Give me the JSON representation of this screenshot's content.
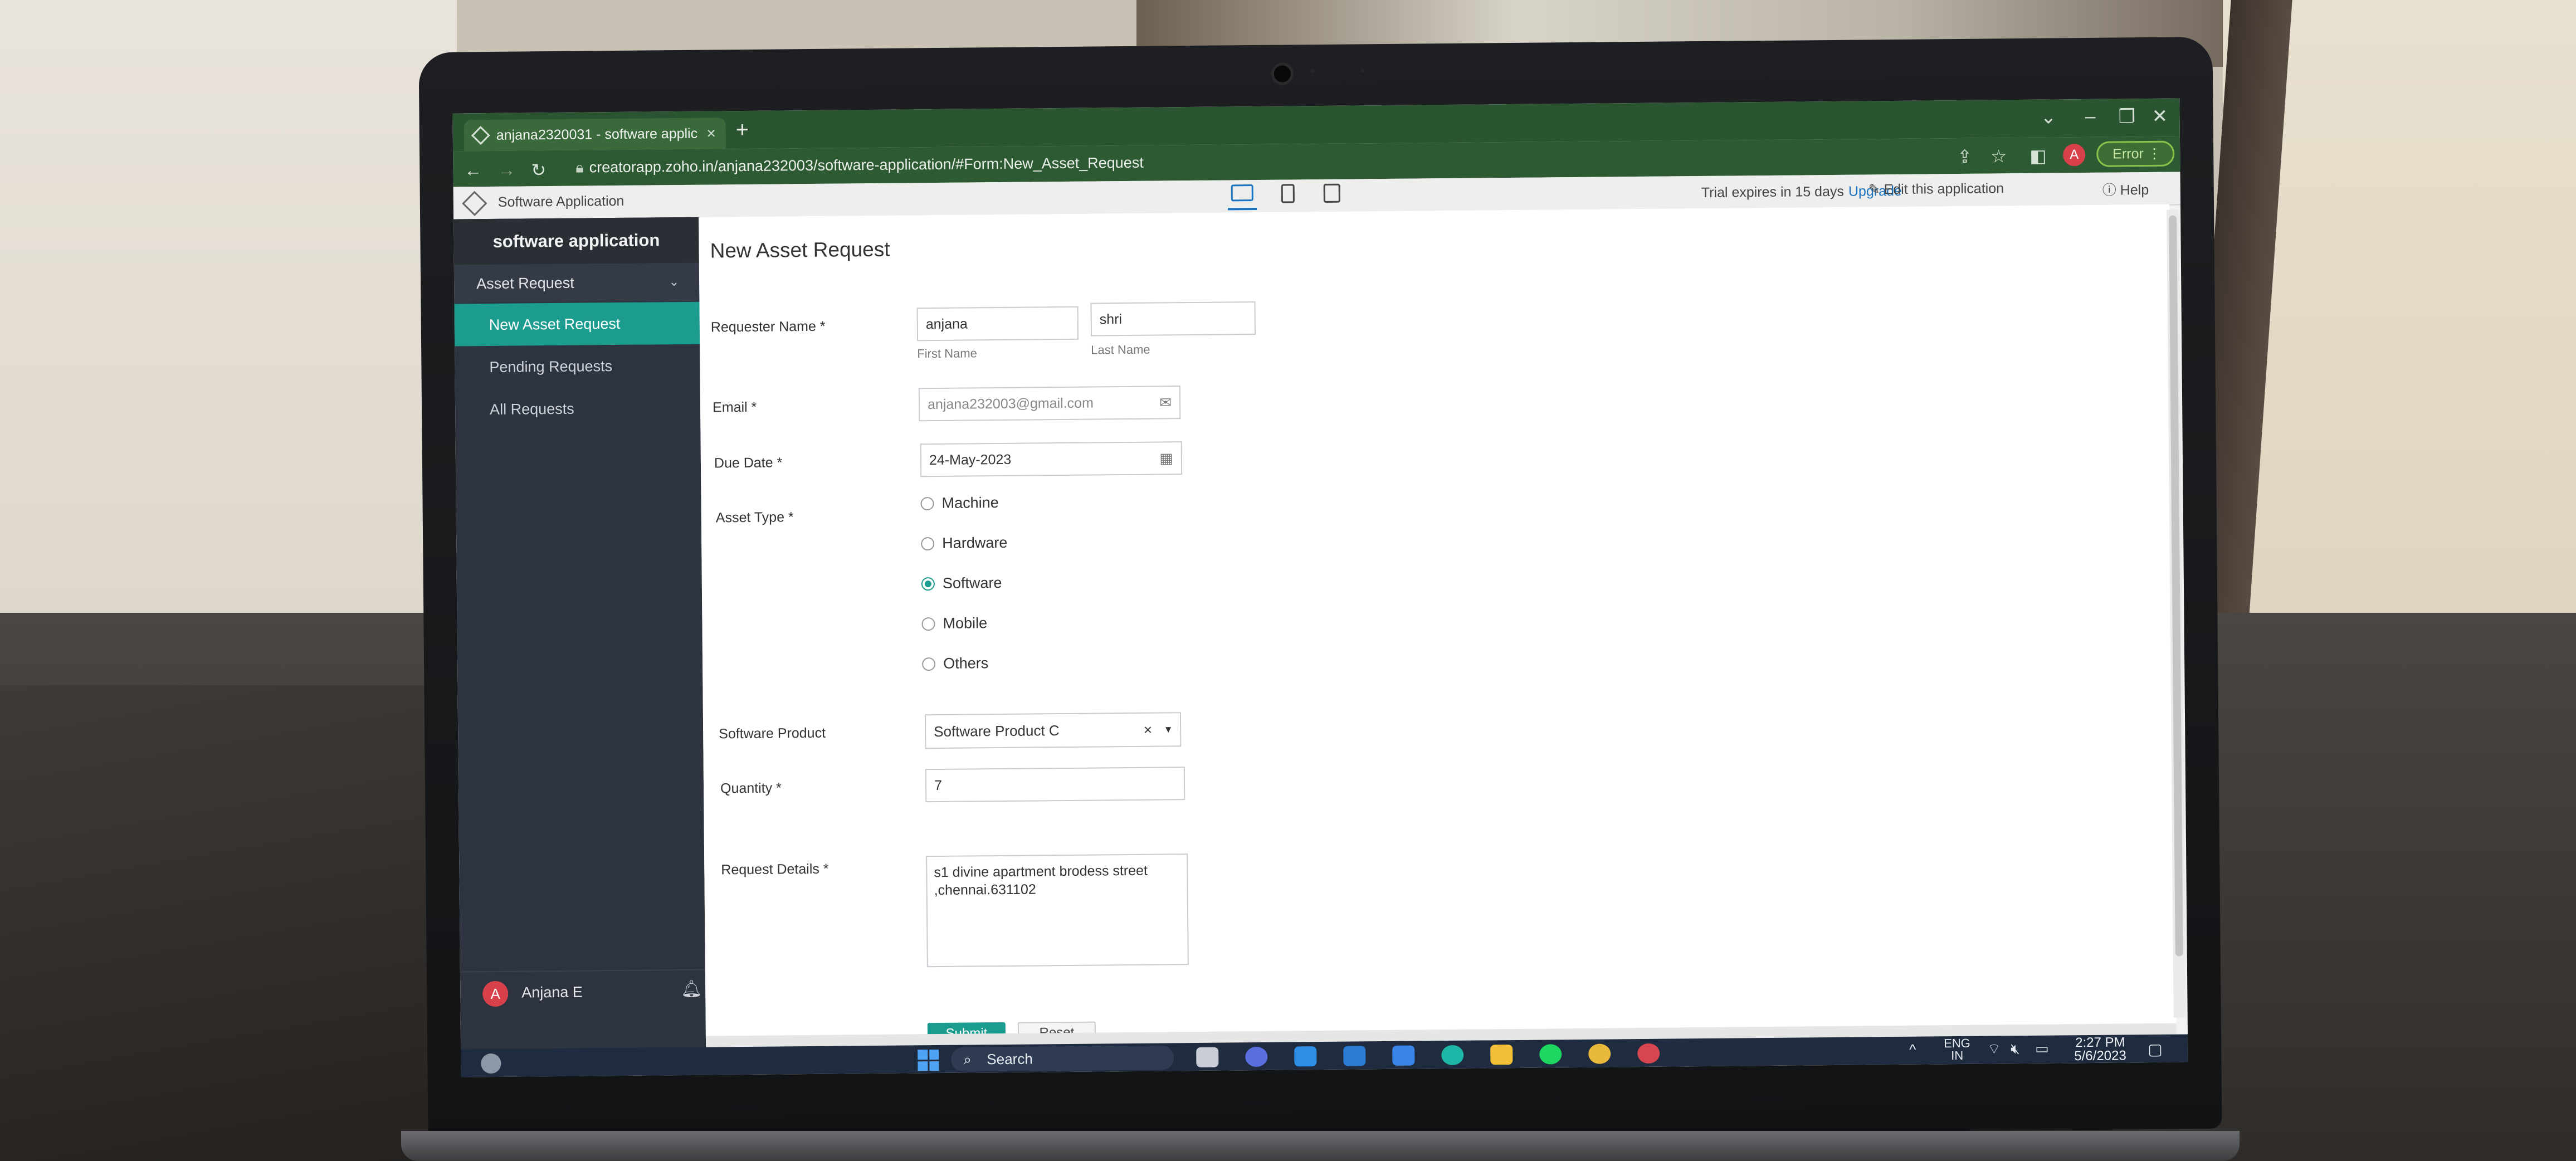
{
  "browser": {
    "tab_title": "anjana2320031 - software applic",
    "tab_close": "×",
    "new_tab": "+",
    "url": "creatorapp.zoho.in/anjana232003/software-application/#Form:New_Asset_Request",
    "profile_initial": "A",
    "error_label": "Error",
    "window_controls": [
      "⌄",
      "–",
      "❐",
      "✕"
    ]
  },
  "app_bar": {
    "app_name": "Software Application",
    "trial_text": "Trial expires in 15 days",
    "upgrade_label": "Upgrade",
    "edit_label": "Edit this application",
    "help_label": "Help"
  },
  "sidebar": {
    "app_title": "software application",
    "group_label": "Asset Request",
    "items": [
      {
        "label": "New Asset Request",
        "active": true
      },
      {
        "label": "Pending Requests",
        "active": false
      },
      {
        "label": "All Requests",
        "active": false
      }
    ],
    "user_initial": "A",
    "user_name": "Anjana E"
  },
  "form": {
    "title": "New Asset Request",
    "requester": {
      "label": "Requester Name *",
      "first_value": "anjana",
      "last_value": "shri",
      "first_caption": "First Name",
      "last_caption": "Last Name"
    },
    "email": {
      "label": "Email *",
      "value": "anjana232003@gmail.com"
    },
    "due_date": {
      "label": "Due Date *",
      "value": "24-May-2023"
    },
    "asset_type": {
      "label": "Asset Type *",
      "options": [
        "Machine",
        "Hardware",
        "Software",
        "Mobile",
        "Others"
      ],
      "selected": "Software"
    },
    "software_product": {
      "label": "Software Product",
      "value": "Software Product C",
      "clear": "×",
      "caret": "▾"
    },
    "quantity": {
      "label": "Quantity *",
      "value": "7"
    },
    "request_details": {
      "label": "Request Details *",
      "value": "s1 divine apartment brodess street\n,chennai.631102"
    },
    "submit_label": "Submit",
    "reset_label": "Reset"
  },
  "taskbar": {
    "search_label": "Search",
    "lang_top": "ENG",
    "lang_bottom": "IN",
    "time": "2:27 PM",
    "date": "5/6/2023"
  },
  "colors": {
    "browser_green": "#2a5530",
    "sidebar_bg": "#2d3440",
    "accent_teal": "#1c9c8e",
    "link_blue": "#1a73c2",
    "avatar_red": "#d8414a",
    "taskbar_bg": "#1f2b3e"
  }
}
